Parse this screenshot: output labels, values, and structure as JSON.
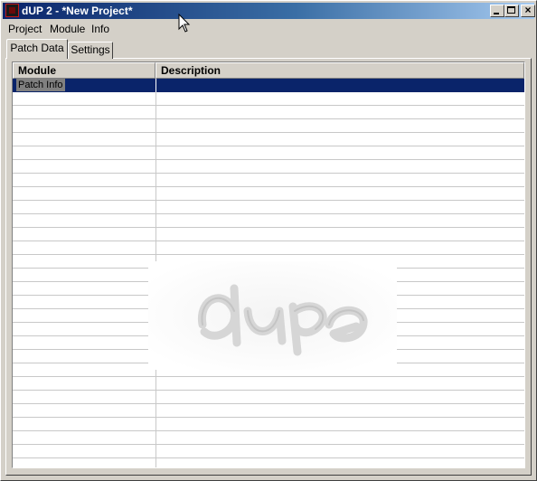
{
  "window": {
    "title": "dUP 2 - *New Project*",
    "app_icon": "dup-app-icon",
    "controls": {
      "minimize_icon": "minimize-icon",
      "maximize_icon": "maximize-icon",
      "close_icon": "close-icon",
      "close_glyph": "×"
    }
  },
  "menu": {
    "project": "Project",
    "module": "Module",
    "info": "Info"
  },
  "tabs": [
    {
      "label": "Patch Data",
      "active": true
    },
    {
      "label": "Settings",
      "active": false
    }
  ],
  "grid": {
    "columns": [
      "Module",
      "Description"
    ],
    "rows": [
      {
        "module": "Patch Info",
        "description": "",
        "selected": true
      }
    ],
    "empty_row_count": 28
  },
  "colors": {
    "selection": "#0a246a",
    "titlebar_start": "#0a246a",
    "titlebar_end": "#a6caf0",
    "face": "#d4d0c8"
  },
  "watermark_icon": "dup-logo-watermark",
  "cursor_icon": "mouse-pointer-icon"
}
